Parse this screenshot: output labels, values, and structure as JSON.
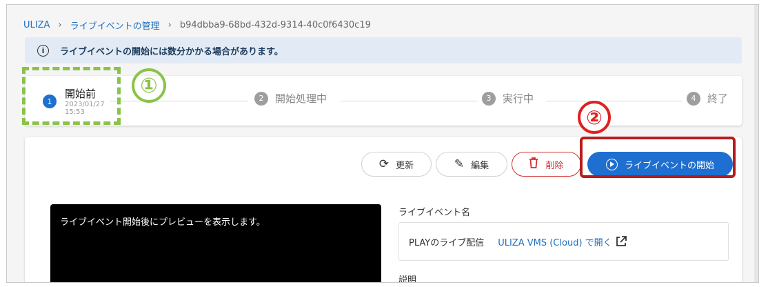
{
  "breadcrumb": {
    "root": "ULIZA",
    "parent": "ライブイベントの管理",
    "current": "b94dbba9-68bd-432d-9314-40c0f6430c19",
    "separator": "›"
  },
  "info_banner": {
    "icon": "info-icon",
    "icon_glyph": "i",
    "text": "ライブイベントの開始には数分かかる場合があります。"
  },
  "stepper": {
    "steps": [
      {
        "num": "1",
        "label": "開始前",
        "date": "2023/01/27",
        "time": "15:53",
        "active": true
      },
      {
        "num": "2",
        "label": "開始処理中",
        "active": false
      },
      {
        "num": "3",
        "label": "実行中",
        "active": false
      },
      {
        "num": "4",
        "label": "終了",
        "active": false
      }
    ]
  },
  "annotations": {
    "marker1": "①",
    "marker2": "②",
    "marker1_color": "#8bc34a",
    "marker2_color": "#e02020"
  },
  "toolbar": {
    "refresh_label": "更新",
    "refresh_icon": "refresh-icon",
    "edit_label": "編集",
    "edit_icon": "pencil-icon",
    "delete_label": "削除",
    "delete_icon": "trash-icon",
    "start_label": "ライブイベントの開始",
    "start_icon": "play-circle-icon"
  },
  "preview": {
    "placeholder": "ライブイベント開始後にプレビューを表示します。"
  },
  "details": {
    "name_label": "ライブイベント名",
    "name_value": "PLAYのライブ配信",
    "open_link": "ULIZA VMS (Cloud) で開く",
    "description_label": "説明"
  },
  "colors": {
    "accent": "#1e6fd0",
    "link": "#1d6fbe",
    "danger": "#d32f2f",
    "banner_bg": "#e2ebf5"
  }
}
